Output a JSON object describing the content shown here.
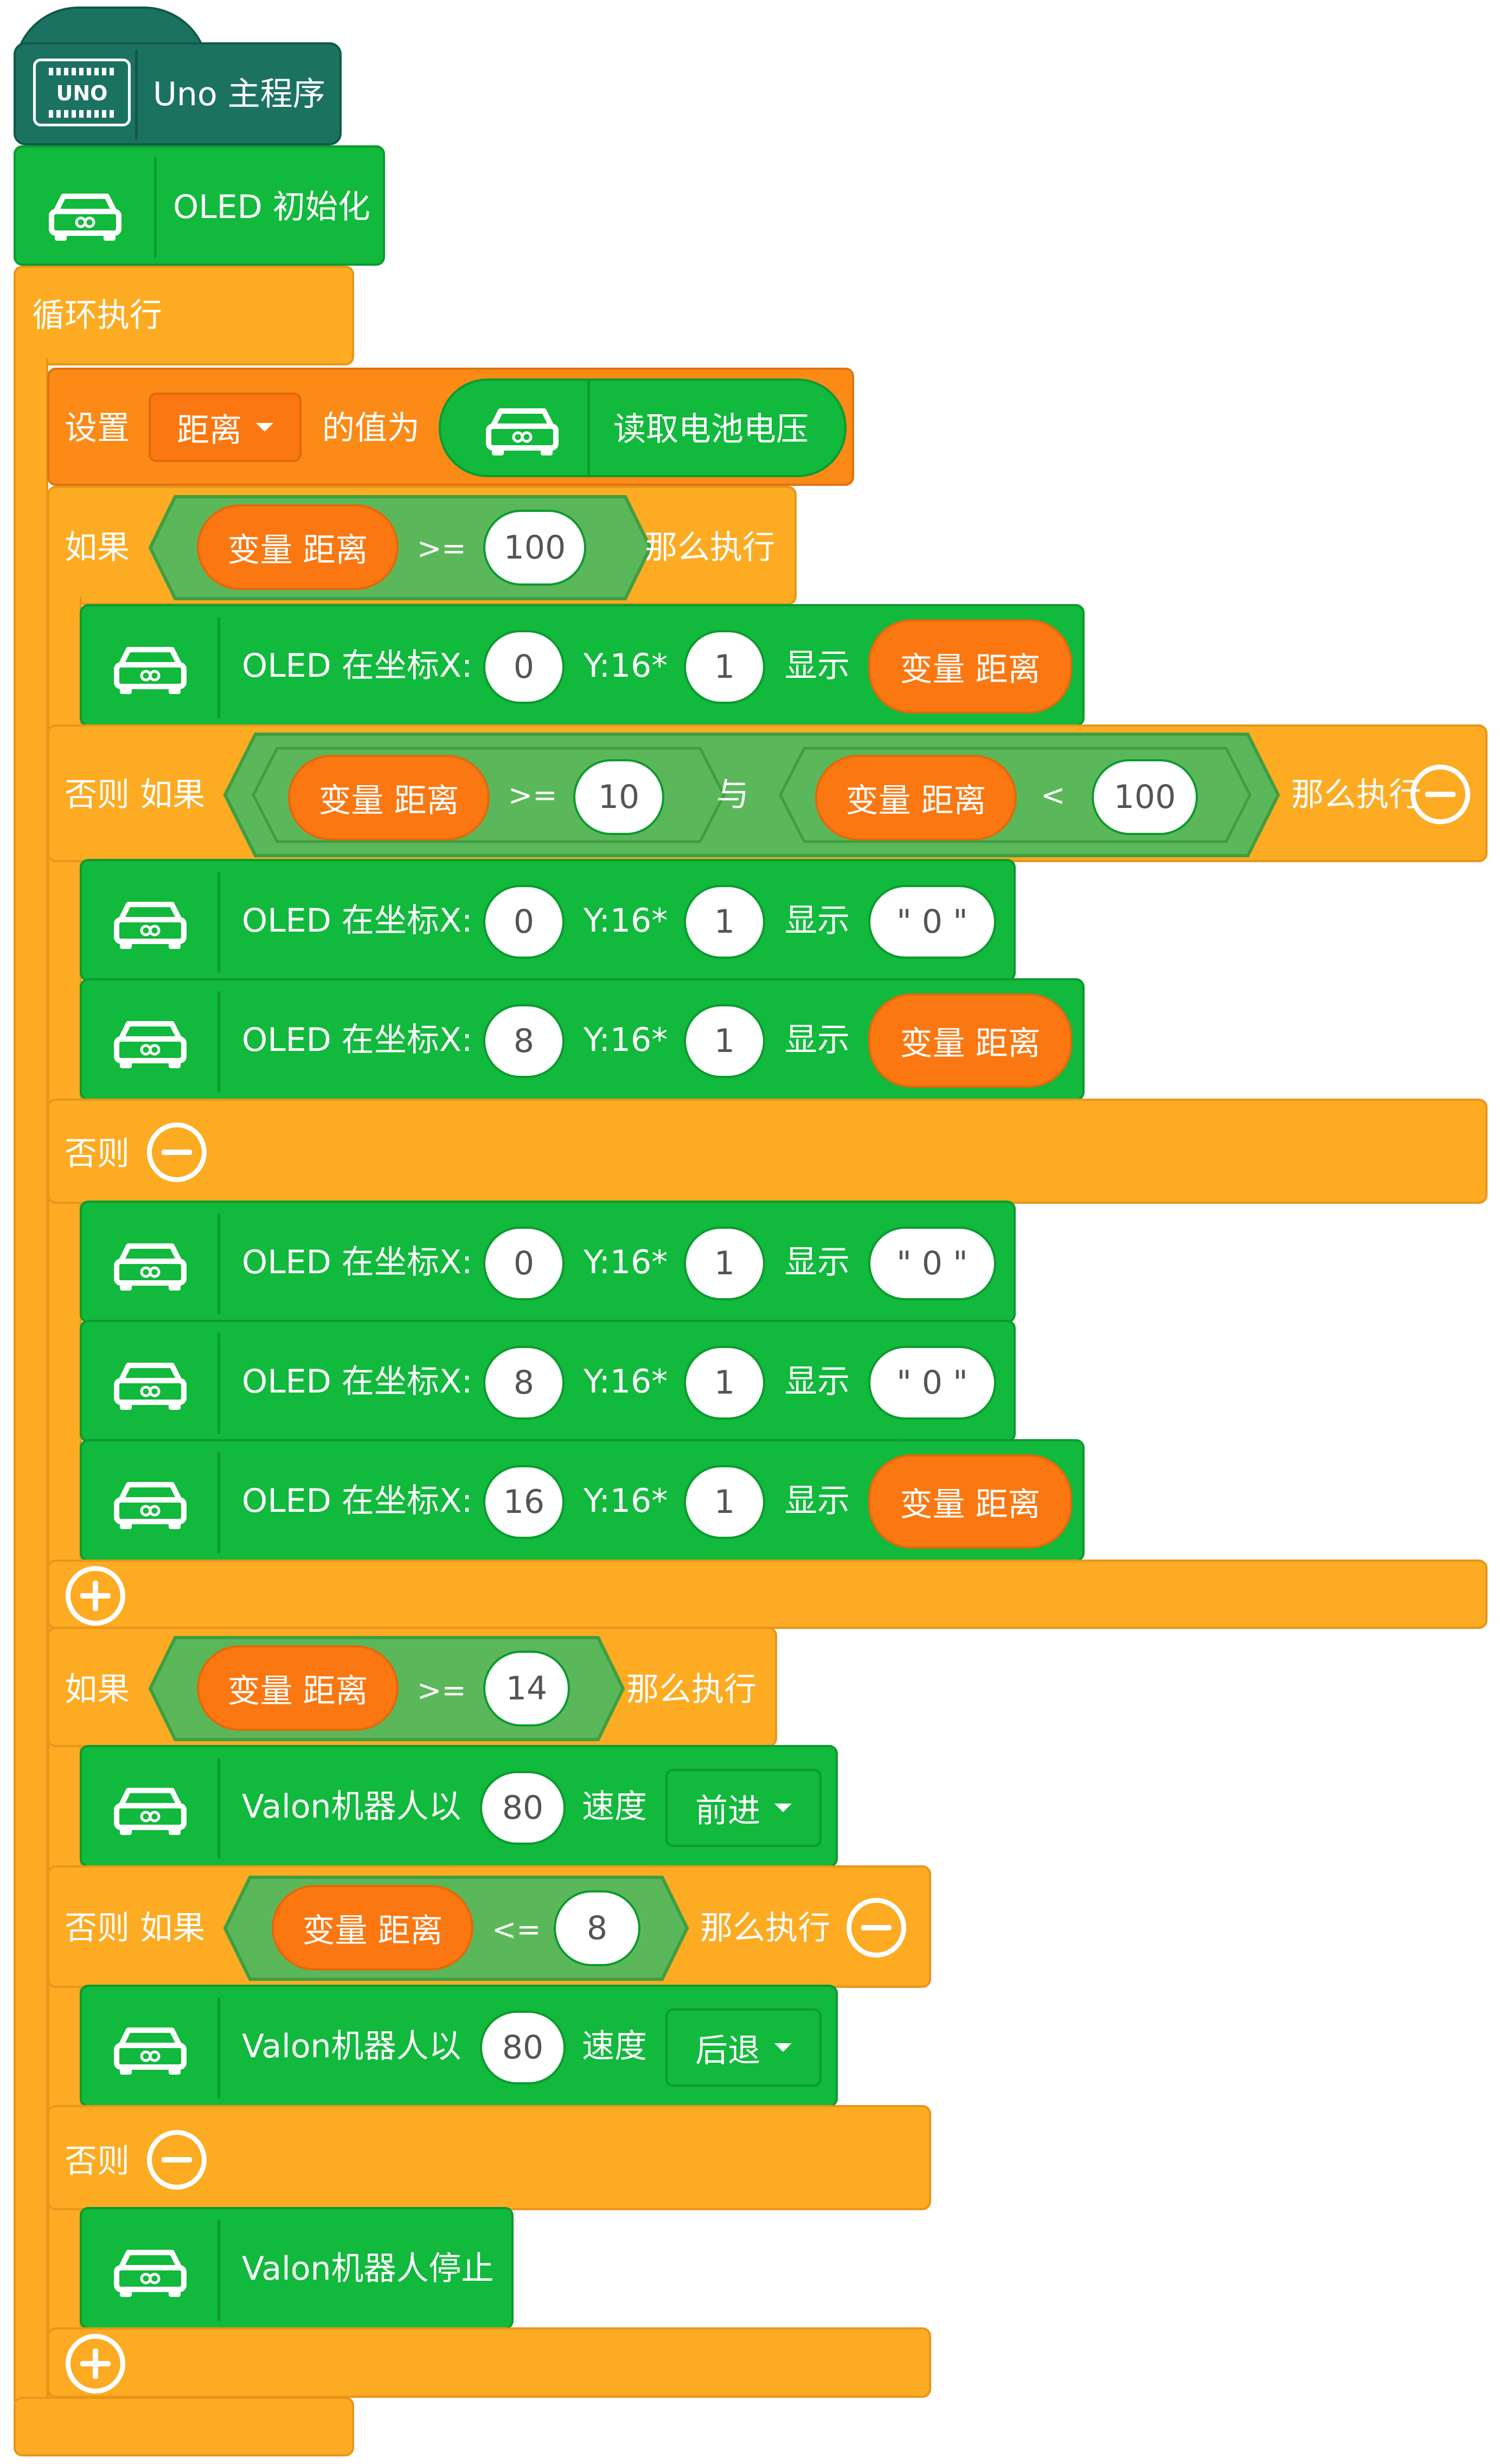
{
  "colors": {
    "hat": "#1c7261",
    "green_block": "#11b93c",
    "control_orange": "#fcab23",
    "set_orange": "#fb8a17",
    "variable_orange": "#fb7711",
    "condition_green": "#5bb85a"
  },
  "hat": {
    "label": "Uno 主程序",
    "icon": "uno-board-icon",
    "board_text": "UNO"
  },
  "oled_init": {
    "label": "OLED 初始化",
    "icon": "robot-car-icon"
  },
  "loop": {
    "label": "循环执行"
  },
  "set_block": {
    "set_label": "设置",
    "variable": "距离",
    "value_label": "的值为",
    "reporter_label": "读取电池电压"
  },
  "if1": {
    "if_label": "如果",
    "var_label": "变量 距离",
    "op": ">=",
    "value": "100",
    "then_label": "那么执行",
    "oled1": {
      "label": "OLED 在坐标X:",
      "x": "0",
      "y_label": "Y:16*",
      "y": "1",
      "show_label": "显示",
      "value": "变量 距离"
    },
    "elseif_label": "否则 如果",
    "cond_a": {
      "var_label": "变量 距离",
      "op": ">=",
      "value": "10"
    },
    "and_label": "与",
    "cond_b": {
      "var_label": "变量 距离",
      "op": "<",
      "value": "100"
    },
    "then_label2": "那么执行",
    "oled2": {
      "label": "OLED 在坐标X:",
      "x": "0",
      "y_label": "Y:16*",
      "y": "1",
      "show_label": "显示",
      "value": "\" 0 \""
    },
    "oled3": {
      "label": "OLED 在坐标X:",
      "x": "8",
      "y_label": "Y:16*",
      "y": "1",
      "show_label": "显示",
      "value": "变量 距离"
    },
    "else_label": "否则",
    "oled4": {
      "label": "OLED 在坐标X:",
      "x": "0",
      "y_label": "Y:16*",
      "y": "1",
      "show_label": "显示",
      "value": "\" 0 \""
    },
    "oled5": {
      "label": "OLED 在坐标X:",
      "x": "8",
      "y_label": "Y:16*",
      "y": "1",
      "show_label": "显示",
      "value": "\" 0 \""
    },
    "oled6": {
      "label": "OLED 在坐标X:",
      "x": "16",
      "y_label": "Y:16*",
      "y": "1",
      "show_label": "显示",
      "value": "变量 距离"
    }
  },
  "if2": {
    "if_label": "如果",
    "var_label": "变量 距离",
    "op": ">=",
    "value": "14",
    "then_label": "那么执行",
    "move1": {
      "label": "Valon机器人以",
      "speed": "80",
      "speed_label": "速度",
      "direction": "前进"
    },
    "elseif_label": "否则 如果",
    "cond": {
      "var_label": "变量 距离",
      "op": "<=",
      "value": "8"
    },
    "then_label2": "那么执行",
    "move2": {
      "label": "Valon机器人以",
      "speed": "80",
      "speed_label": "速度",
      "direction": "后退"
    },
    "else_label": "否则",
    "stop": {
      "label": "Valon机器人停止"
    }
  }
}
